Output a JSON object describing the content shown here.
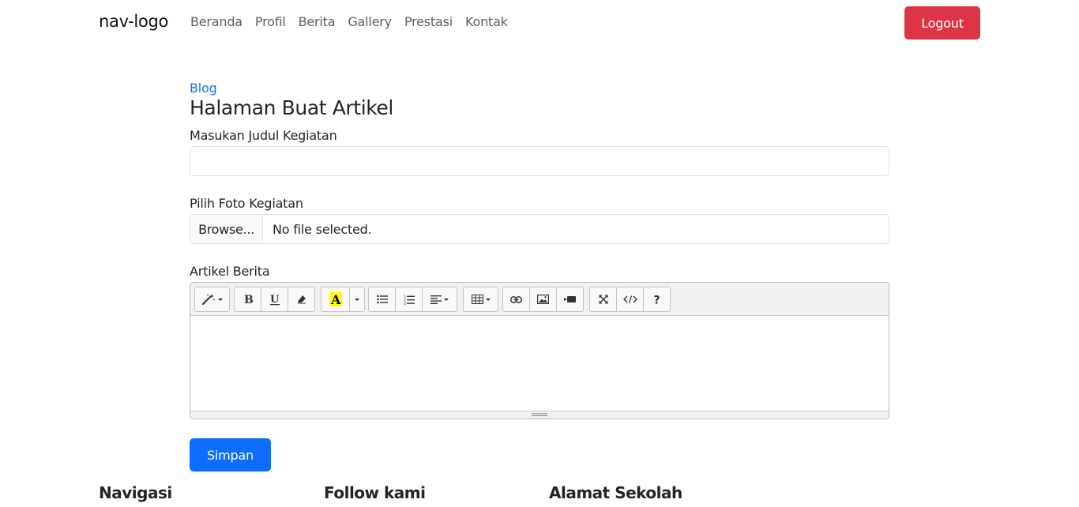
{
  "nav": {
    "logo": "nav-logo",
    "links": [
      "Beranda",
      "Profil",
      "Berita",
      "Gallery",
      "Prestasi",
      "Kontak"
    ],
    "logout_label": "Logout"
  },
  "page": {
    "breadcrumb": "Blog",
    "title": "Halaman Buat Artikel"
  },
  "form": {
    "title_label": "Masukan Judul Kegiatan",
    "title_value": "",
    "photo_label": "Pilih Foto Kegiatan",
    "browse_label": "Browse...",
    "file_status": "No file selected.",
    "article_label": "Artikel Berita",
    "save_label": "Simpan"
  },
  "editor": {
    "toolbar": [
      [
        "magic-wand-icon"
      ],
      [
        "bold-icon",
        "underline-icon",
        "eraser-icon"
      ],
      [
        "highlight-color-icon",
        "color-dropdown-icon"
      ],
      [
        "unordered-list-icon",
        "ordered-list-icon",
        "paragraph-align-icon"
      ],
      [
        "table-icon"
      ],
      [
        "link-icon",
        "picture-icon",
        "video-icon"
      ],
      [
        "fullscreen-icon",
        "code-view-icon",
        "help-icon"
      ]
    ],
    "highlight_color": "#ffff00"
  },
  "footer": {
    "nav_heading": "Navigasi",
    "follow_heading": "Follow kami",
    "address_heading": "Alamat Sekolah"
  },
  "colors": {
    "primary": "#0d6efd",
    "danger": "#dc3545"
  }
}
